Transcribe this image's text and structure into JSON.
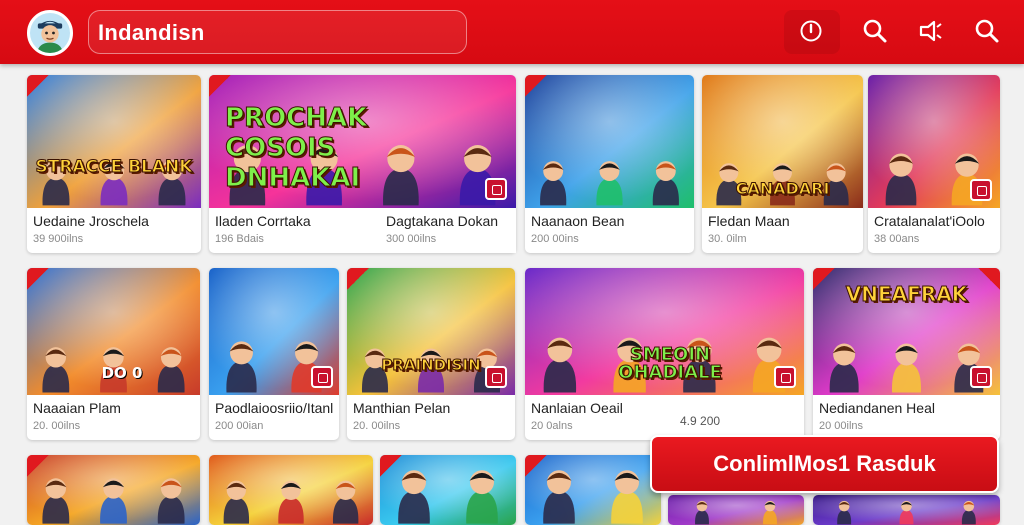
{
  "header": {
    "search_value": "Indandisn",
    "icons": [
      "avatar",
      "power-icon",
      "search-icon",
      "share-icon",
      "search-icon-2"
    ]
  },
  "cards": [
    {
      "title": "Uedaine Jroschela",
      "meta": "39 900ilns",
      "thumb_text": "STRACCE BLANK",
      "palette": [
        "#2c7de0",
        "#f0a13a",
        "#7b2cbf"
      ]
    },
    {
      "title": "Iladen Corrtaka",
      "meta": "196 Bdais",
      "thumb_text": "PROCHAK COSOIS DNHAKAI",
      "palette": [
        "#a31eb8",
        "#f6339a",
        "#3a1aa8"
      ]
    },
    {
      "title": "Dagtakana Dokan",
      "meta": "300 00ilns",
      "thumb_text": "",
      "palette": [
        "#1d6fd1",
        "#5ac8f0",
        "#e03a2a"
      ]
    },
    {
      "title": "Naanaon Bean",
      "meta": "200 00ins",
      "thumb_text": "",
      "palette": [
        "#1b3f9a",
        "#3fa2ea",
        "#1fbf6a"
      ]
    },
    {
      "title": "Fledan Maan",
      "meta": "30. 0ilm",
      "thumb_text": "CANADARI",
      "palette": [
        "#e07a1a",
        "#f5c54a",
        "#8a2b1a"
      ]
    },
    {
      "title": "Cratalanalat'iOolo",
      "meta": "38 00ans",
      "thumb_text": "",
      "palette": [
        "#6a1fa8",
        "#e23a5a",
        "#f5a623"
      ]
    },
    {
      "title": "Naaaian Plam",
      "meta": "20. 00ilns",
      "thumb_text": "DO 0",
      "palette": [
        "#2b6fd6",
        "#f28c2b",
        "#c73a2a"
      ]
    },
    {
      "title": "Paodlaioosriio/Itanl",
      "meta": "200 00ian",
      "thumb_text": "",
      "palette": [
        "#1a63c9",
        "#3aa0ef",
        "#e03a2a"
      ]
    },
    {
      "title": "Manthian Pelan",
      "meta": "20. 00ilns",
      "thumb_text": "PRAINDISIN",
      "palette": [
        "#2aa44a",
        "#f5c23a",
        "#7a2aa8"
      ]
    },
    {
      "title": "Nanlaian Oeail",
      "meta": "20 0alns",
      "thumb_text": "SMEOIN OHADIALE",
      "palette": [
        "#6a2ac9",
        "#f23aa0",
        "#f5a623"
      ]
    },
    {
      "title": "Nediandanen Heal",
      "meta": "20 00ilns",
      "thumb_text": "VNEAFRAK",
      "palette": [
        "#2a2a6a",
        "#e03ac9",
        "#f5c23a"
      ]
    },
    {
      "title": "",
      "meta": "",
      "thumb_text": "",
      "palette": [
        "#c9402a",
        "#f5a623",
        "#2a63c9"
      ]
    },
    {
      "title": "",
      "meta": "",
      "thumb_text": "",
      "palette": [
        "#e05a1a",
        "#f5d23a",
        "#c92a2a"
      ]
    },
    {
      "title": "",
      "meta": "",
      "thumb_text": "",
      "palette": [
        "#1a8ad6",
        "#3ac9ef",
        "#2aa44a"
      ]
    },
    {
      "title": "",
      "meta": "",
      "thumb_text": "",
      "palette": [
        "#1a63c9",
        "#3aa0ef",
        "#f5d23a"
      ]
    },
    {
      "title": "",
      "meta": "",
      "thumb_text": "",
      "palette": [
        "#6a1fa8",
        "#a03ac9",
        "#f5a623"
      ]
    },
    {
      "title": "",
      "meta": "",
      "thumb_text": "",
      "palette": [
        "#3a1a8a",
        "#6a3ac9",
        "#f23a5a"
      ]
    }
  ],
  "floating_meta": "4.9 200",
  "cta": {
    "label": "ConlimlMos1 Rasduk"
  },
  "colors": {
    "brand_red": "#e50f17",
    "card_bg": "#ffffff",
    "page_bg": "#f1f1f1"
  }
}
